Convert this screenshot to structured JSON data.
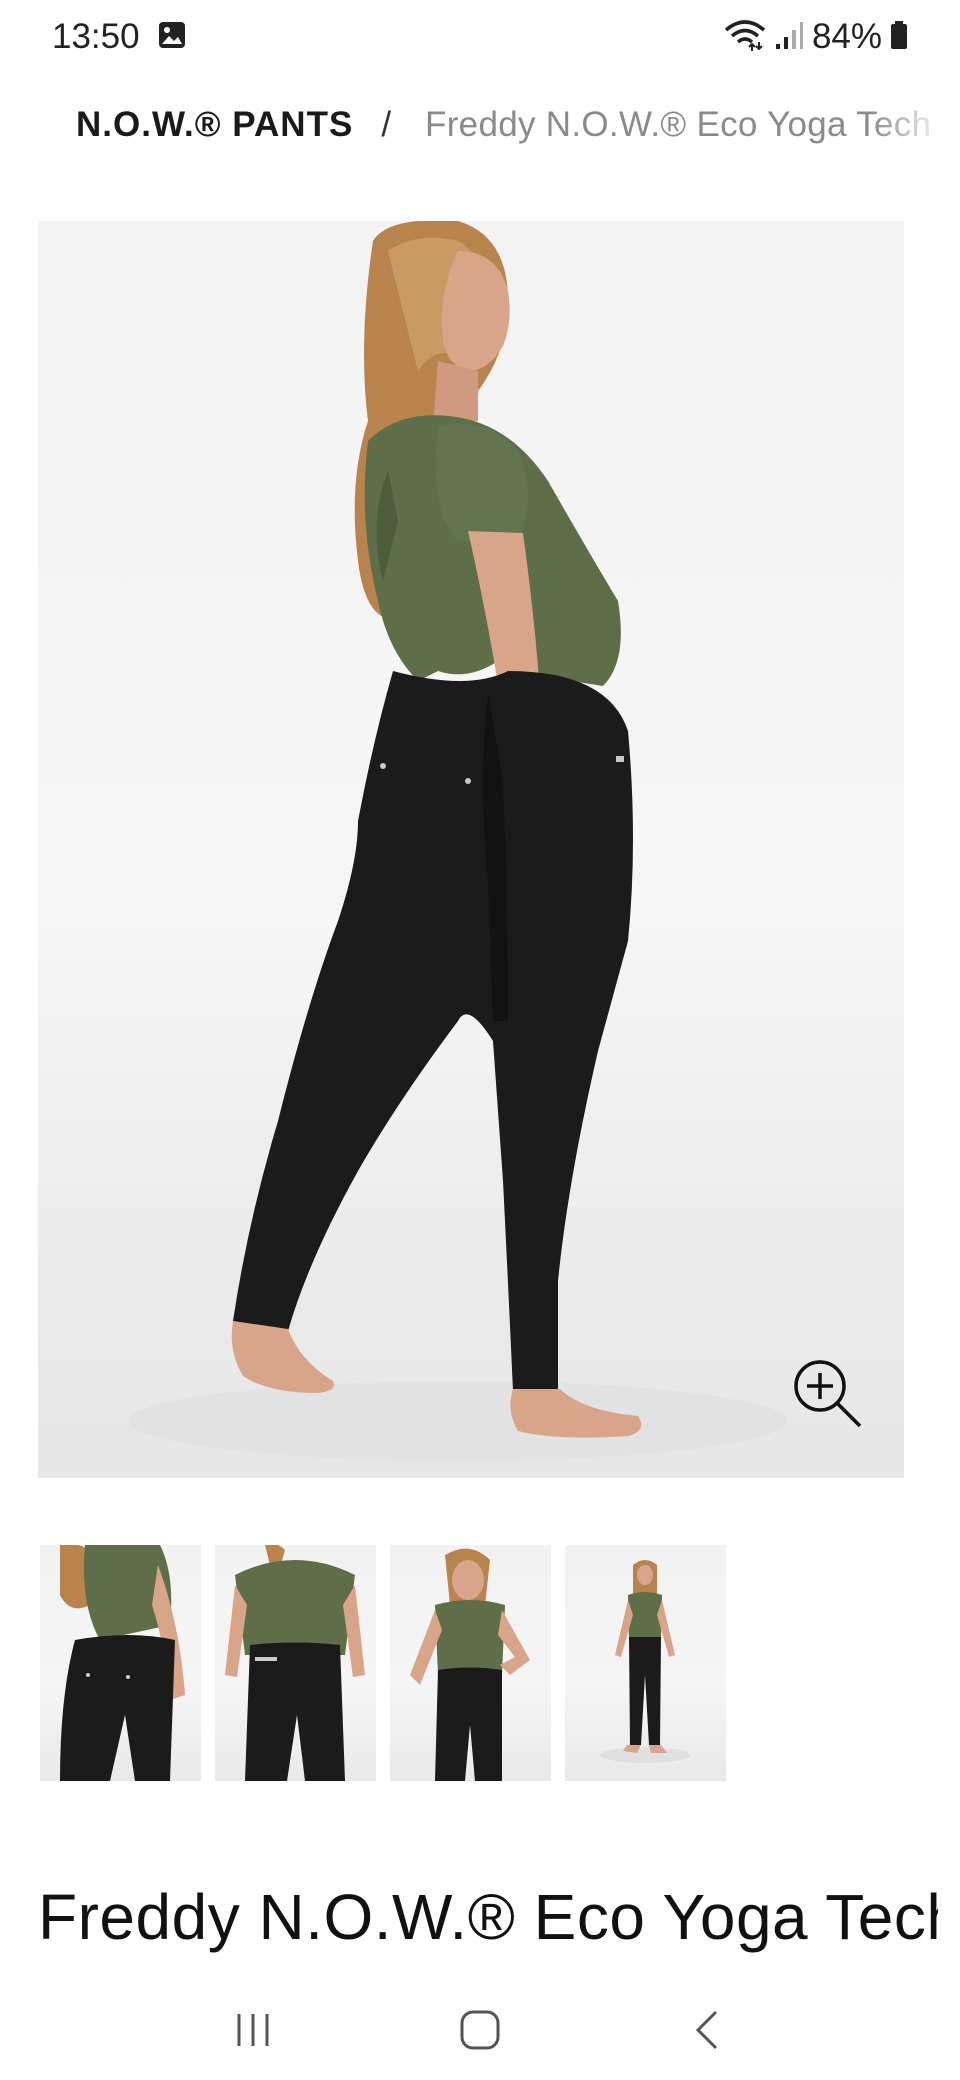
{
  "status_bar": {
    "time": "13:50",
    "battery_percent": "84%",
    "icons": [
      "gallery-icon",
      "wifi-icon",
      "signal-icon",
      "battery-icon"
    ]
  },
  "breadcrumb": {
    "root": "N.O.W.® PANTS",
    "separator": "/",
    "current": "Freddy N.O.W.® Eco Yoga Tech"
  },
  "product": {
    "title": "Freddy N.O.W.® Eco Yoga Tech",
    "main_image_alt": "Model wearing black leggings and green top, back view",
    "zoom_icon": "zoom-in-icon",
    "thumbnails": [
      "Back view close-up",
      "Front view close-up",
      "Front view hand on hip",
      "Full body front view"
    ]
  },
  "nav_bar": {
    "icons": [
      "recent-apps-icon",
      "home-icon",
      "back-icon"
    ]
  },
  "colors": {
    "top_green": "#5d6e48",
    "leggings_black": "#1b1b1b",
    "skin": "#d9a58a",
    "hair": "#b9834e",
    "breadcrumb_gray": "#8a8a8a"
  }
}
